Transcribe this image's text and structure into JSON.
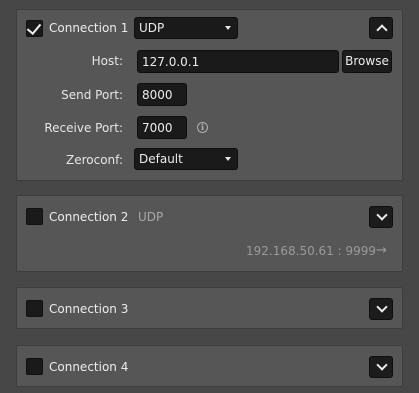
{
  "connections": [
    {
      "label": "Connection 1",
      "checked": true,
      "protocol": "UDP",
      "expanded": true,
      "host_label": "Host:",
      "host_value": "127.0.0.1",
      "browse_label": "Browse",
      "send_port_label": "Send Port:",
      "send_port_value": "8000",
      "receive_port_label": "Receive Port:",
      "receive_port_value": "7000",
      "zeroconf_label": "Zeroconf:",
      "zeroconf_value": "Default"
    },
    {
      "label": "Connection 2",
      "checked": false,
      "protocol": "UDP",
      "expanded": false,
      "address": "192.168.50.61 : 9999",
      "arrow_glyph": "→"
    },
    {
      "label": "Connection 3",
      "checked": false,
      "expanded": false
    },
    {
      "label": "Connection 4",
      "checked": false,
      "expanded": false
    }
  ],
  "icons": {
    "info_glyph": "i"
  }
}
